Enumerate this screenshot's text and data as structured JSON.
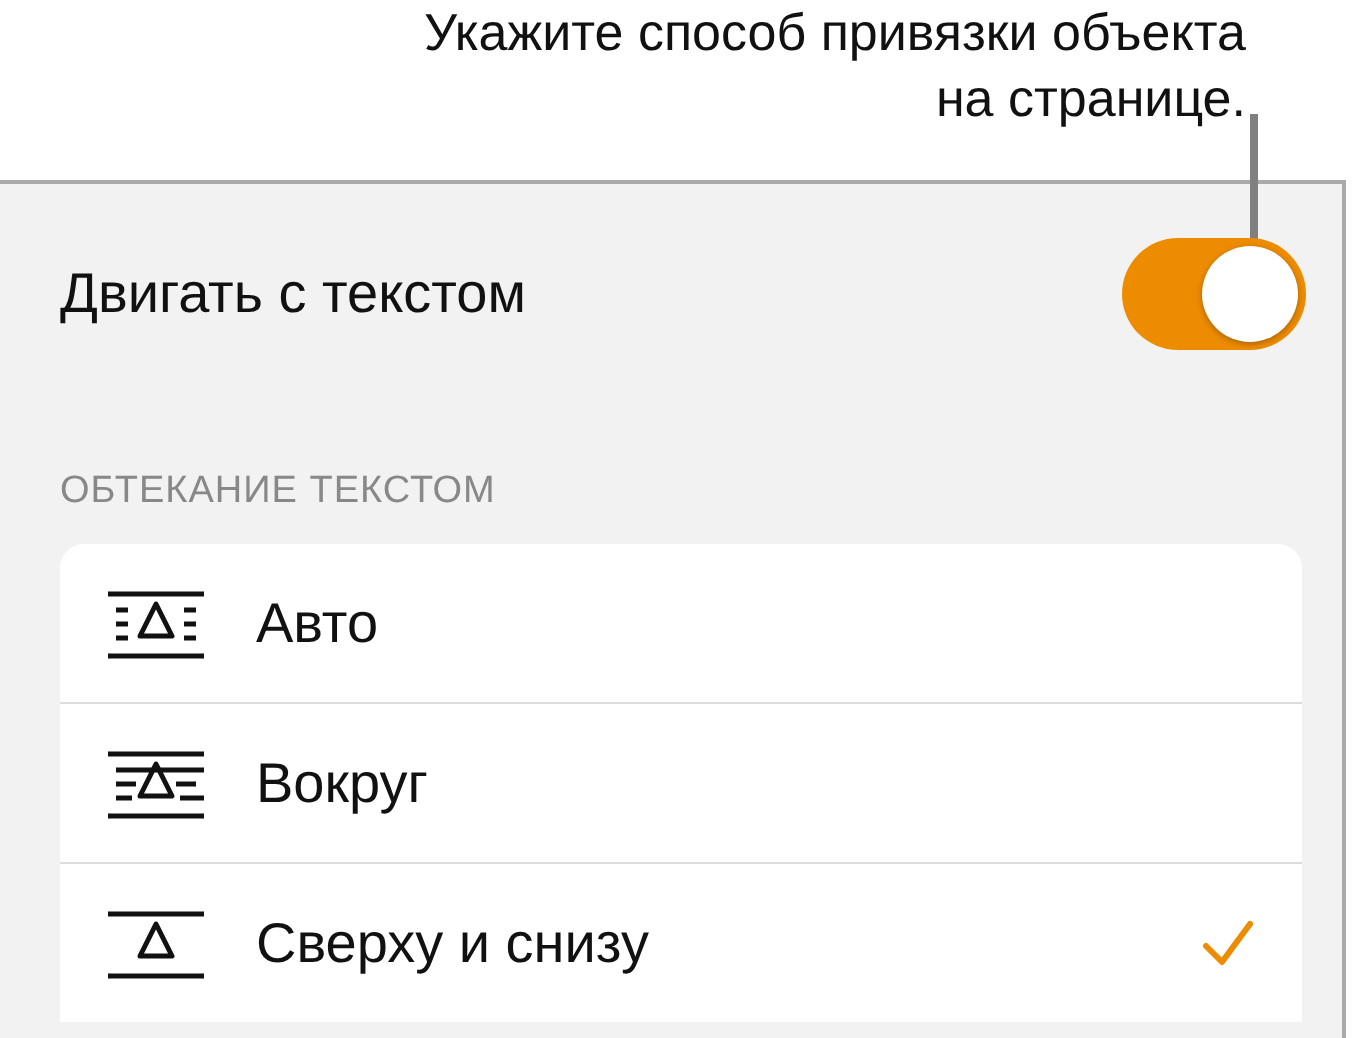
{
  "callout": {
    "text": "Укажите способ привязки объекта на странице."
  },
  "move_with_text": {
    "label": "Двигать с текстом",
    "on": true
  },
  "wrap_section": {
    "header": "ОБТЕКАНИЕ ТЕКСТОМ",
    "options": [
      {
        "kind": "auto",
        "label": "Авто",
        "selected": false
      },
      {
        "kind": "around",
        "label": "Вокруг",
        "selected": false
      },
      {
        "kind": "above_below",
        "label": "Сверху и снизу",
        "selected": true
      }
    ]
  }
}
